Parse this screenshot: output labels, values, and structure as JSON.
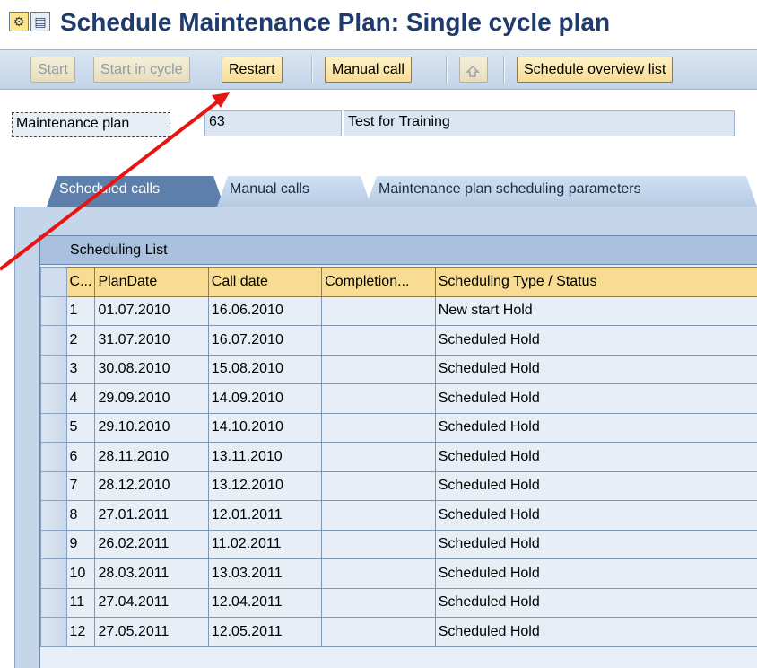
{
  "title": "Schedule Maintenance Plan: Single cycle plan",
  "title_icons": [
    "program-icon",
    "document-icon"
  ],
  "toolbar": {
    "start": "Start",
    "start_in_cycle": "Start in cycle",
    "restart": "Restart",
    "manual_call": "Manual call",
    "release_icon": "release-icon",
    "schedule_overview_list": "Schedule overview list"
  },
  "header": {
    "plan_label": "Maintenance plan",
    "plan_number": "63",
    "plan_description": "Test for Training"
  },
  "tabs": [
    {
      "label": "Scheduled calls",
      "active": true
    },
    {
      "label": "Manual calls",
      "active": false
    },
    {
      "label": "Maintenance plan scheduling parameters",
      "active": false
    }
  ],
  "scheduling_list": {
    "title": "Scheduling List",
    "columns": [
      "C...",
      "PlanDate",
      "Call date",
      "Completion...",
      "Scheduling Type / Status"
    ],
    "rows": [
      {
        "c": "1",
        "plan_date": "01.07.2010",
        "call_date": "16.06.2010",
        "completion": "",
        "status": "New start  Hold"
      },
      {
        "c": "2",
        "plan_date": "31.07.2010",
        "call_date": "16.07.2010",
        "completion": "",
        "status": "Scheduled  Hold"
      },
      {
        "c": "3",
        "plan_date": "30.08.2010",
        "call_date": "15.08.2010",
        "completion": "",
        "status": "Scheduled  Hold"
      },
      {
        "c": "4",
        "plan_date": "29.09.2010",
        "call_date": "14.09.2010",
        "completion": "",
        "status": "Scheduled  Hold"
      },
      {
        "c": "5",
        "plan_date": "29.10.2010",
        "call_date": "14.10.2010",
        "completion": "",
        "status": "Scheduled  Hold"
      },
      {
        "c": "6",
        "plan_date": "28.11.2010",
        "call_date": "13.11.2010",
        "completion": "",
        "status": "Scheduled  Hold"
      },
      {
        "c": "7",
        "plan_date": "28.12.2010",
        "call_date": "13.12.2010",
        "completion": "",
        "status": "Scheduled  Hold"
      },
      {
        "c": "8",
        "plan_date": "27.01.2011",
        "call_date": "12.01.2011",
        "completion": "",
        "status": "Scheduled  Hold"
      },
      {
        "c": "9",
        "plan_date": "26.02.2011",
        "call_date": "11.02.2011",
        "completion": "",
        "status": "Scheduled  Hold"
      },
      {
        "c": "10",
        "plan_date": "28.03.2011",
        "call_date": "13.03.2011",
        "completion": "",
        "status": "Scheduled  Hold"
      },
      {
        "c": "11",
        "plan_date": "27.04.2011",
        "call_date": "12.04.2011",
        "completion": "",
        "status": "Scheduled  Hold"
      },
      {
        "c": "12",
        "plan_date": "27.05.2011",
        "call_date": "12.05.2011",
        "completion": "",
        "status": "Scheduled  Hold"
      }
    ]
  },
  "colors": {
    "title": "#1f3b6d",
    "button_fill": "#f5dc98",
    "header_fill": "#f7dc91",
    "annotation_arrow": "#e8140f"
  },
  "annotation": {
    "type": "arrow",
    "points_to": "restart-button"
  }
}
